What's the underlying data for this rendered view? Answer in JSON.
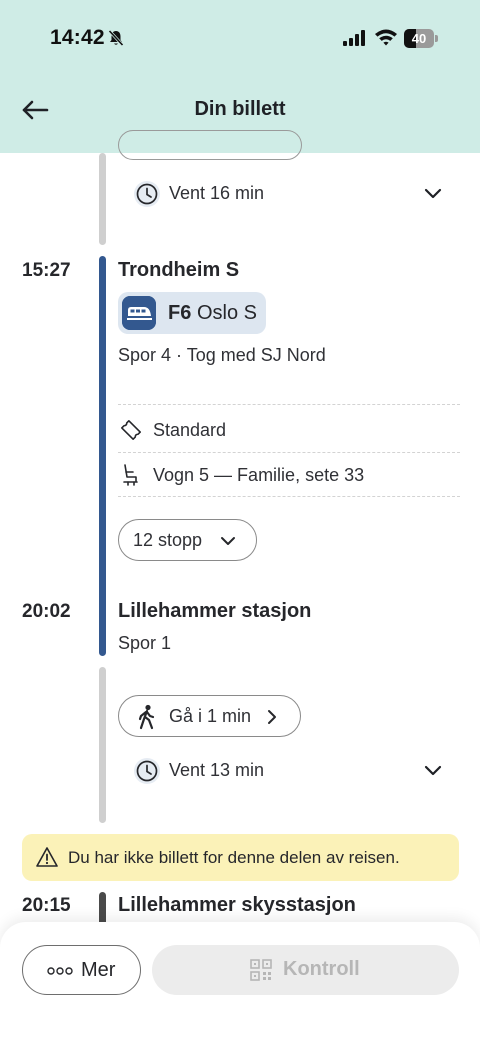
{
  "status_bar": {
    "time": "14:42",
    "battery": "40",
    "battery_level": 0.4
  },
  "header": {
    "title": "Din billett"
  },
  "wait_1": {
    "text": "Vent 16 min"
  },
  "leg": {
    "departure_time": "15:27",
    "departure_stop": "Trondheim S",
    "line_code": "F6",
    "line_destination": "Oslo S",
    "platform_info": "Spor 4 · Tog med SJ Nord",
    "ticket_class": "Standard",
    "seat_info": "Vogn 5 — Familie, sete 33",
    "stops_label": "12 stopp",
    "arrival_time": "20:02",
    "arrival_stop": "Lillehammer stasjon",
    "arrival_platform": "Spor 1"
  },
  "walk": {
    "label": "Gå i 1 min"
  },
  "wait_2": {
    "text": "Vent 13 min"
  },
  "warning": {
    "text": "Du har ikke billett for denne delen av reisen."
  },
  "next_stop": {
    "time": "20:15",
    "name": "Lillehammer skysstasjon"
  },
  "actions": {
    "more_label": "Mer",
    "control_label": "Kontroll"
  },
  "colors": {
    "header_bg": "#cfece6",
    "line_blue": "#33588f",
    "warning_bg": "#fbf2b8",
    "badge_bg": "#dde6f0"
  },
  "icons": [
    "back-arrow-icon",
    "bell-slash-icon",
    "signal-icon",
    "wifi-icon",
    "clock-icon",
    "chevron-down-icon",
    "train-icon",
    "ticket-icon",
    "seat-icon",
    "walk-icon",
    "chevron-right-icon",
    "warning-icon",
    "more-dots-icon",
    "qr-code-icon"
  ]
}
